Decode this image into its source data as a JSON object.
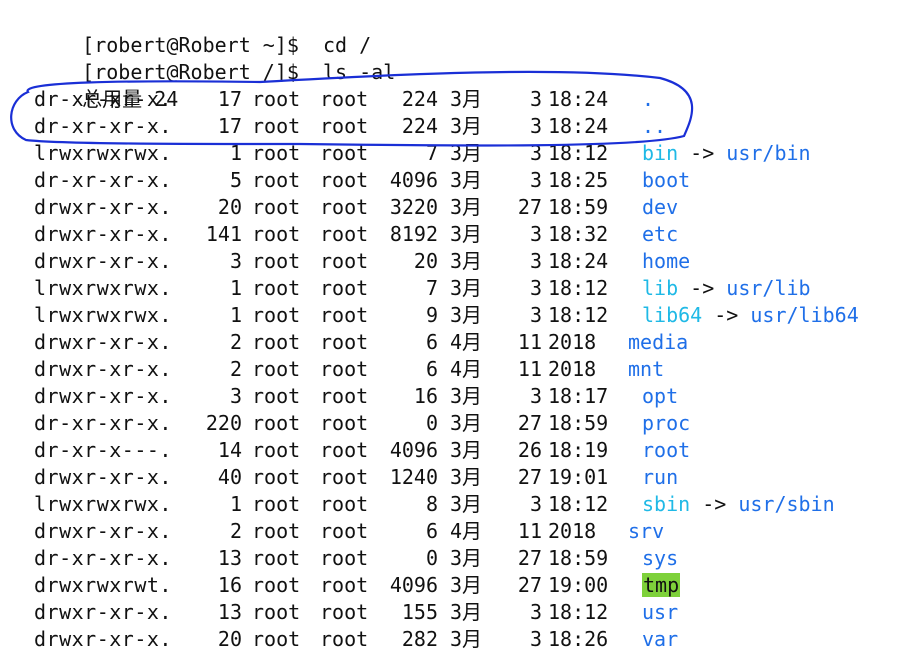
{
  "prompts": [
    {
      "user": "robert",
      "host": "Robert",
      "cwd": "~",
      "command": "cd /"
    },
    {
      "user": "robert",
      "host": "Robert",
      "cwd": "/",
      "command": "ls -al"
    }
  ],
  "total_label": "总用量",
  "total_value": "24",
  "entries": [
    {
      "perm": "dr-xr-xr-x.",
      "links": "17",
      "owner": "root",
      "group": "root",
      "size": "224",
      "month": "3月",
      "day": "3",
      "time": "18:24",
      "name": ".",
      "type": "dir",
      "target": ""
    },
    {
      "perm": "dr-xr-xr-x.",
      "links": "17",
      "owner": "root",
      "group": "root",
      "size": "224",
      "month": "3月",
      "day": "3",
      "time": "18:24",
      "name": "..",
      "type": "dir",
      "target": ""
    },
    {
      "perm": "lrwxrwxrwx.",
      "links": "1",
      "owner": "root",
      "group": "root",
      "size": "7",
      "month": "3月",
      "day": "3",
      "time": "18:12",
      "name": "bin",
      "type": "link",
      "target": "usr/bin"
    },
    {
      "perm": "dr-xr-xr-x.",
      "links": "5",
      "owner": "root",
      "group": "root",
      "size": "4096",
      "month": "3月",
      "day": "3",
      "time": "18:25",
      "name": "boot",
      "type": "dir",
      "target": ""
    },
    {
      "perm": "drwxr-xr-x.",
      "links": "20",
      "owner": "root",
      "group": "root",
      "size": "3220",
      "month": "3月",
      "day": "27",
      "time": "18:59",
      "name": "dev",
      "type": "dir",
      "target": ""
    },
    {
      "perm": "drwxr-xr-x.",
      "links": "141",
      "owner": "root",
      "group": "root",
      "size": "8192",
      "month": "3月",
      "day": "3",
      "time": "18:32",
      "name": "etc",
      "type": "dir",
      "target": ""
    },
    {
      "perm": "drwxr-xr-x.",
      "links": "3",
      "owner": "root",
      "group": "root",
      "size": "20",
      "month": "3月",
      "day": "3",
      "time": "18:24",
      "name": "home",
      "type": "dir",
      "target": ""
    },
    {
      "perm": "lrwxrwxrwx.",
      "links": "1",
      "owner": "root",
      "group": "root",
      "size": "7",
      "month": "3月",
      "day": "3",
      "time": "18:12",
      "name": "lib",
      "type": "link",
      "target": "usr/lib"
    },
    {
      "perm": "lrwxrwxrwx.",
      "links": "1",
      "owner": "root",
      "group": "root",
      "size": "9",
      "month": "3月",
      "day": "3",
      "time": "18:12",
      "name": "lib64",
      "type": "link",
      "target": "usr/lib64"
    },
    {
      "perm": "drwxr-xr-x.",
      "links": "2",
      "owner": "root",
      "group": "root",
      "size": "6",
      "month": "4月",
      "day": "11",
      "time": "2018",
      "name": "media",
      "type": "dir",
      "target": ""
    },
    {
      "perm": "drwxr-xr-x.",
      "links": "2",
      "owner": "root",
      "group": "root",
      "size": "6",
      "month": "4月",
      "day": "11",
      "time": "2018",
      "name": "mnt",
      "type": "dir",
      "target": ""
    },
    {
      "perm": "drwxr-xr-x.",
      "links": "3",
      "owner": "root",
      "group": "root",
      "size": "16",
      "month": "3月",
      "day": "3",
      "time": "18:17",
      "name": "opt",
      "type": "dir",
      "target": ""
    },
    {
      "perm": "dr-xr-xr-x.",
      "links": "220",
      "owner": "root",
      "group": "root",
      "size": "0",
      "month": "3月",
      "day": "27",
      "time": "18:59",
      "name": "proc",
      "type": "dir",
      "target": ""
    },
    {
      "perm": "dr-xr-x---.",
      "links": "14",
      "owner": "root",
      "group": "root",
      "size": "4096",
      "month": "3月",
      "day": "26",
      "time": "18:19",
      "name": "root",
      "type": "dir",
      "target": ""
    },
    {
      "perm": "drwxr-xr-x.",
      "links": "40",
      "owner": "root",
      "group": "root",
      "size": "1240",
      "month": "3月",
      "day": "27",
      "time": "19:01",
      "name": "run",
      "type": "dir",
      "target": ""
    },
    {
      "perm": "lrwxrwxrwx.",
      "links": "1",
      "owner": "root",
      "group": "root",
      "size": "8",
      "month": "3月",
      "day": "3",
      "time": "18:12",
      "name": "sbin",
      "type": "link",
      "target": "usr/sbin"
    },
    {
      "perm": "drwxr-xr-x.",
      "links": "2",
      "owner": "root",
      "group": "root",
      "size": "6",
      "month": "4月",
      "day": "11",
      "time": "2018",
      "name": "srv",
      "type": "dir",
      "target": ""
    },
    {
      "perm": "dr-xr-xr-x.",
      "links": "13",
      "owner": "root",
      "group": "root",
      "size": "0",
      "month": "3月",
      "day": "27",
      "time": "18:59",
      "name": "sys",
      "type": "dir",
      "target": ""
    },
    {
      "perm": "drwxrwxrwt.",
      "links": "16",
      "owner": "root",
      "group": "root",
      "size": "4096",
      "month": "3月",
      "day": "27",
      "time": "19:00",
      "name": "tmp",
      "type": "sticky",
      "target": ""
    },
    {
      "perm": "drwxr-xr-x.",
      "links": "13",
      "owner": "root",
      "group": "root",
      "size": "155",
      "month": "3月",
      "day": "3",
      "time": "18:12",
      "name": "usr",
      "type": "dir",
      "target": ""
    },
    {
      "perm": "drwxr-xr-x.",
      "links": "20",
      "owner": "root",
      "group": "root",
      "size": "282",
      "month": "3月",
      "day": "3",
      "time": "18:26",
      "name": "var",
      "type": "dir",
      "target": ""
    }
  ],
  "link_arrow": "->",
  "colors": {
    "dir": "#1f6fe8",
    "link": "#1fb9e6",
    "sticky_bg": "#7ed13a",
    "annotation": "#1a2fd6"
  },
  "annotation": {
    "shape": "hand-drawn-ellipse",
    "covers_entries": [
      0,
      1
    ]
  }
}
